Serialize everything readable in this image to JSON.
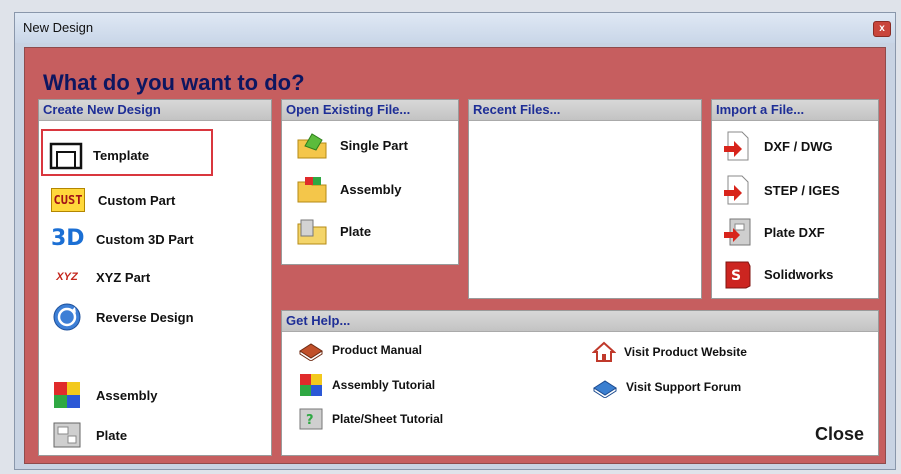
{
  "window": {
    "title": "New Design",
    "close_glyph": "x"
  },
  "heading": "What do you want to do?",
  "create_new": {
    "header": "Create New Design",
    "items": [
      {
        "label": "Template",
        "icon": "template-icon"
      },
      {
        "label": "Custom Part",
        "icon": "cust-icon"
      },
      {
        "label": "Custom 3D Part",
        "icon": "3d-icon"
      },
      {
        "label": "XYZ Part",
        "icon": "xyz-icon"
      },
      {
        "label": "Reverse Design",
        "icon": "reverse-icon"
      },
      {
        "label": "Assembly",
        "icon": "assembly-icon"
      },
      {
        "label": "Plate",
        "icon": "plate-icon"
      }
    ],
    "icon_text": {
      "cust": "CUST",
      "three_d": "3D",
      "xyz": "XYZ"
    }
  },
  "open_existing": {
    "header": "Open Existing File...",
    "items": [
      {
        "label": "Single Part",
        "icon": "single-part-icon"
      },
      {
        "label": "Assembly",
        "icon": "assembly-folder-icon"
      },
      {
        "label": "Plate",
        "icon": "plate-folder-icon"
      }
    ]
  },
  "recent_files": {
    "header": "Recent Files..."
  },
  "import_file": {
    "header": "Import a File...",
    "items": [
      {
        "label": "DXF / DWG",
        "icon": "import-arrow-icon"
      },
      {
        "label": "STEP / IGES",
        "icon": "import-arrow-icon"
      },
      {
        "label": "Plate DXF",
        "icon": "plate-dxf-icon"
      },
      {
        "label": "Solidworks",
        "icon": "solidworks-icon"
      }
    ]
  },
  "get_help": {
    "header": "Get Help...",
    "items": [
      {
        "label": "Product Manual",
        "icon": "book-icon"
      },
      {
        "label": "Assembly Tutorial",
        "icon": "assembly-tutorial-icon"
      },
      {
        "label": "Plate/Sheet Tutorial",
        "icon": "plate-tutorial-icon"
      },
      {
        "label": "Visit Product Website",
        "icon": "home-icon"
      },
      {
        "label": "Visit Support Forum",
        "icon": "forum-icon"
      }
    ]
  },
  "close_label": "Close",
  "colors": {
    "accent": "#c65e5f",
    "header_text": "#1e2e96",
    "heading": "#0d1660",
    "highlight": "#d9363e"
  }
}
